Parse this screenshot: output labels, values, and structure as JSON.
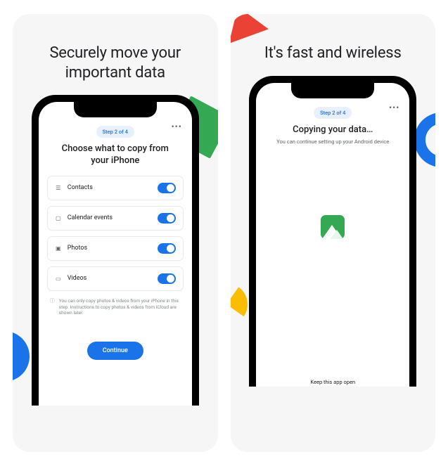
{
  "panels": [
    {
      "title": "Securely move your important data"
    },
    {
      "title": "It's fast and wireless"
    }
  ],
  "phone1": {
    "step": "Step 2 of 4",
    "title": "Choose what to copy from your iPhone",
    "items": [
      {
        "icon": "👤",
        "label": "Contacts",
        "on": true
      },
      {
        "icon": "📅",
        "label": "Calendar events",
        "on": true
      },
      {
        "icon": "🖼",
        "label": "Photos",
        "on": true
      },
      {
        "icon": "🎞",
        "label": "Videos",
        "on": true
      }
    ],
    "note": "You can only copy photos & videos from your iPhone in this step. Instructions to copy photos & videos from iCloud are shown later.",
    "button": "Continue"
  },
  "phone2": {
    "step": "Step 2 of 4",
    "title": "Copying your data…",
    "sub": "You can continue setting up your Android device",
    "bottom": "Keep this app open"
  }
}
